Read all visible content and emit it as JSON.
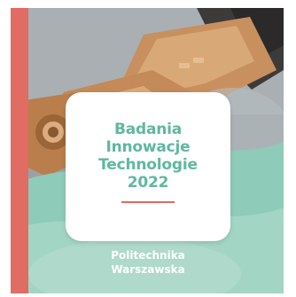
{
  "cover": {
    "title_lines": [
      "Badania",
      "Innowacje",
      "Technologie",
      "2022"
    ],
    "publisher_lines": [
      "Politechnika",
      "Warszawska"
    ]
  },
  "colors": {
    "accent_red": "#e06c63",
    "title_green": "#5fb89f",
    "wave_green": "#8fcbb9",
    "photo_grey": "#9aa1a6",
    "copper": "#c8905e"
  },
  "image": {
    "description_icon": "copper-mechanical-component-photo-icon"
  }
}
